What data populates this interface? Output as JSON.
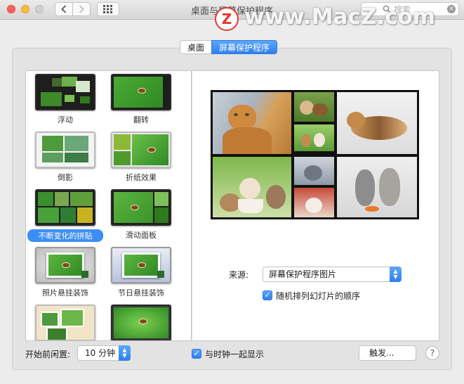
{
  "window": {
    "title": "桌面与屏幕保护程序",
    "search_placeholder": "搜索",
    "watermark": "www.MacZ.com",
    "watermark_logo": "Z"
  },
  "tabs": [
    {
      "label": "桌面",
      "selected": false
    },
    {
      "label": "屏幕保护程序",
      "selected": true
    }
  ],
  "screensavers": [
    {
      "label": "浮动"
    },
    {
      "label": "翻转"
    },
    {
      "label": "倒影"
    },
    {
      "label": "折纸效果"
    },
    {
      "label": "不断变化的拼贴",
      "selected": true
    },
    {
      "label": "滑动面板"
    },
    {
      "label": "照片悬挂装饰"
    },
    {
      "label": "节日悬挂装饰"
    },
    {
      "label": ""
    },
    {
      "label": ""
    }
  ],
  "source": {
    "label": "来源:",
    "value": "屏幕保护程序图片"
  },
  "shuffle": {
    "label": "随机排列幻灯片的顺序",
    "checked": true
  },
  "idle": {
    "label": "开始前闲置:",
    "value": "10 分钟"
  },
  "show_clock": {
    "label": "与时钟一起显示",
    "checked": true
  },
  "hot_corners": {
    "label": "触发..."
  },
  "help": {
    "label": "?"
  },
  "colors": {
    "accent": "#3d8ef2",
    "window_bg": "#ececec"
  }
}
